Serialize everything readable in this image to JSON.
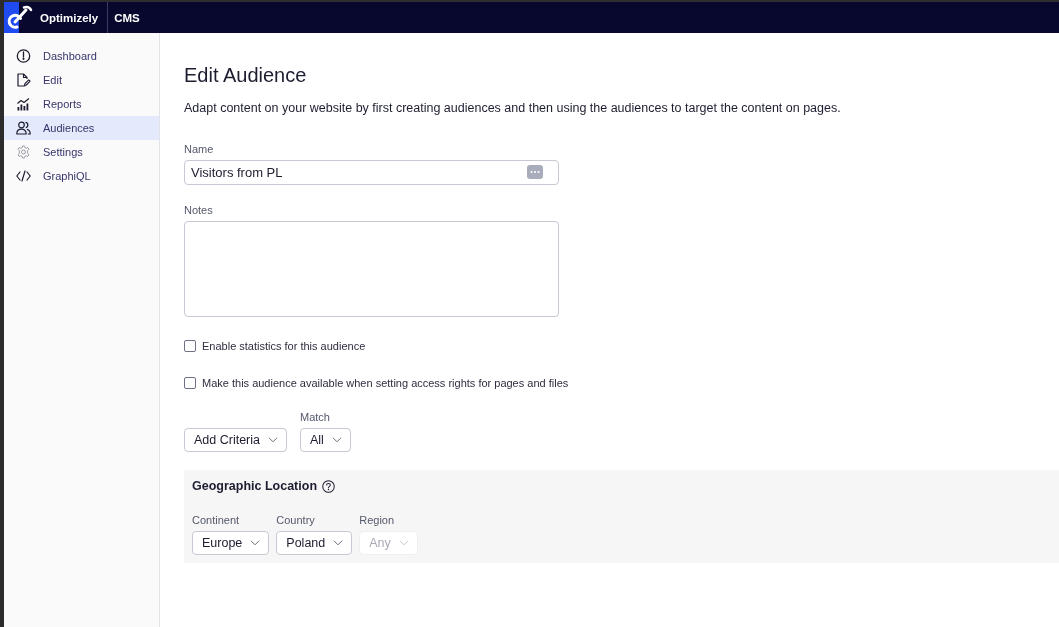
{
  "header": {
    "brand": "Optimizely",
    "product": "CMS"
  },
  "sidebar": {
    "items": [
      {
        "label": "Dashboard",
        "selected": false
      },
      {
        "label": "Edit",
        "selected": false
      },
      {
        "label": "Reports",
        "selected": false
      },
      {
        "label": "Audiences",
        "selected": true
      },
      {
        "label": "Settings",
        "selected": false
      },
      {
        "label": "GraphiQL",
        "selected": false
      }
    ]
  },
  "page": {
    "title": "Edit Audience",
    "description": "Adapt content on your website by first creating audiences and then using the audiences to target the content on pages."
  },
  "form": {
    "name": {
      "label": "Name",
      "value": "Visitors from PL"
    },
    "notes": {
      "label": "Notes"
    },
    "options": [
      {
        "label": "Enable statistics for this audience",
        "checked": false
      },
      {
        "label": "Make this audience available when setting access rights for pages and files",
        "checked": false
      }
    ],
    "add_criteria": {
      "value": "Add Criteria"
    },
    "match": {
      "label": "Match",
      "value": "All"
    }
  },
  "criteria": [
    {
      "title": "Geographic Location",
      "fields": [
        {
          "label": "Continent",
          "value": "Europe",
          "disabled": false
        },
        {
          "label": "Country",
          "value": "Poland",
          "disabled": false
        },
        {
          "label": "Region",
          "value": "Any",
          "disabled": true
        }
      ]
    }
  ]
}
